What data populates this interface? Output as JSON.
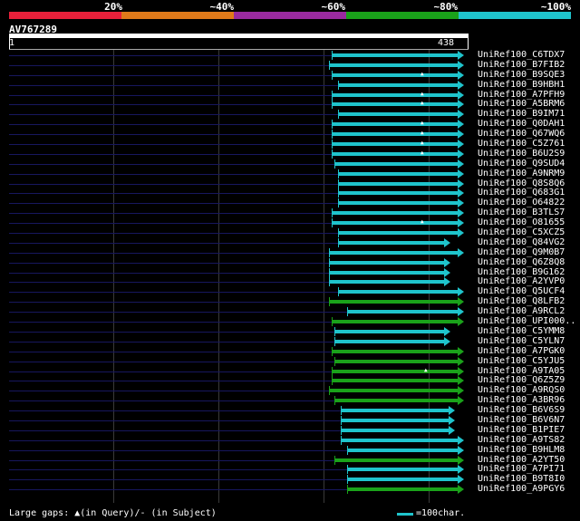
{
  "identity_scale": {
    "labels": [
      "20%",
      "~40%",
      "~60%",
      "~80%",
      "~100%"
    ],
    "colors": [
      "#e8203a",
      "#e07a1a",
      "#9a2aa0",
      "#1aa21a",
      "#1fc4cc"
    ]
  },
  "query": {
    "name": "AV767289",
    "start": "1",
    "end": "438"
  },
  "hits": [
    {
      "label": "UniRef100_C6TDX7",
      "color": "#1fc4cc",
      "start": 366,
      "end": 512,
      "gap": null
    },
    {
      "label": "UniRef100_B7FIB2",
      "color": "#1fc4cc",
      "start": 363,
      "end": 512,
      "gap": null
    },
    {
      "label": "UniRef100_B9SQE3",
      "color": "#1fc4cc",
      "start": 366,
      "end": 512,
      "gap": 466
    },
    {
      "label": "UniRef100_B9HBH1",
      "color": "#1fc4cc",
      "start": 373,
      "end": 512,
      "gap": null
    },
    {
      "label": "UniRef100_A7PFH9",
      "color": "#1fc4cc",
      "start": 366,
      "end": 512,
      "gap": 466
    },
    {
      "label": "UniRef100_A5BRM6",
      "color": "#1fc4cc",
      "start": 366,
      "end": 512,
      "gap": 466
    },
    {
      "label": "UniRef100_B9IM71",
      "color": "#1fc4cc",
      "start": 373,
      "end": 512,
      "gap": null
    },
    {
      "label": "UniRef100_Q0DAH1",
      "color": "#1fc4cc",
      "start": 366,
      "end": 512,
      "gap": 466
    },
    {
      "label": "UniRef100_Q67WQ6",
      "color": "#1fc4cc",
      "start": 366,
      "end": 512,
      "gap": 466
    },
    {
      "label": "UniRef100_C5Z761",
      "color": "#1fc4cc",
      "start": 366,
      "end": 512,
      "gap": 466
    },
    {
      "label": "UniRef100_B6U2S9",
      "color": "#1fc4cc",
      "start": 366,
      "end": 512,
      "gap": 466
    },
    {
      "label": "UniRef100_Q9SUD4",
      "color": "#1fc4cc",
      "start": 369,
      "end": 512,
      "gap": null
    },
    {
      "label": "UniRef100_A9NRM9",
      "color": "#1fc4cc",
      "start": 373,
      "end": 512,
      "gap": null
    },
    {
      "label": "UniRef100_Q8S8Q6",
      "color": "#1fc4cc",
      "start": 373,
      "end": 512,
      "gap": null
    },
    {
      "label": "UniRef100_Q683G1",
      "color": "#1fc4cc",
      "start": 373,
      "end": 512,
      "gap": null
    },
    {
      "label": "UniRef100_O64822",
      "color": "#1fc4cc",
      "start": 373,
      "end": 512,
      "gap": null
    },
    {
      "label": "UniRef100_B3TLS7",
      "color": "#1fc4cc",
      "start": 366,
      "end": 512,
      "gap": null
    },
    {
      "label": "UniRef100_O81655",
      "color": "#1fc4cc",
      "start": 366,
      "end": 512,
      "gap": 466
    },
    {
      "label": "UniRef100_C5XCZ5",
      "color": "#1fc4cc",
      "start": 373,
      "end": 512,
      "gap": null
    },
    {
      "label": "UniRef100_Q84VG2",
      "color": "#1fc4cc",
      "start": 373,
      "end": 497,
      "gap": null
    },
    {
      "label": "UniRef100_Q9M0B7",
      "color": "#1fc4cc",
      "start": 363,
      "end": 512,
      "gap": null
    },
    {
      "label": "UniRef100_Q6Z8Q8",
      "color": "#1fc4cc",
      "start": 363,
      "end": 497,
      "gap": null
    },
    {
      "label": "UniRef100_B9G162",
      "color": "#1fc4cc",
      "start": 363,
      "end": 497,
      "gap": null
    },
    {
      "label": "UniRef100_A2YVP0",
      "color": "#1fc4cc",
      "start": 363,
      "end": 497,
      "gap": null
    },
    {
      "label": "UniRef100_Q5UCF4",
      "color": "#1fc4cc",
      "start": 373,
      "end": 512,
      "gap": null
    },
    {
      "label": "UniRef100_Q8LFB2",
      "color": "#1aa21a",
      "start": 363,
      "end": 512,
      "gap": null
    },
    {
      "label": "UniRef100_A9RCL2",
      "color": "#1fc4cc",
      "start": 383,
      "end": 512,
      "gap": null
    },
    {
      "label": "UniRef100_UPI000..",
      "color": "#1aa21a",
      "start": 366,
      "end": 512,
      "gap": null
    },
    {
      "label": "UniRef100_C5YMM8",
      "color": "#1fc4cc",
      "start": 369,
      "end": 497,
      "gap": null
    },
    {
      "label": "UniRef100_C5YLN7",
      "color": "#1fc4cc",
      "start": 369,
      "end": 497,
      "gap": null
    },
    {
      "label": "UniRef100_A7PGK0",
      "color": "#1aa21a",
      "start": 366,
      "end": 512,
      "gap": null
    },
    {
      "label": "UniRef100_C5YJU5",
      "color": "#1aa21a",
      "start": 369,
      "end": 512,
      "gap": null
    },
    {
      "label": "UniRef100_A9TA05",
      "color": "#1aa21a",
      "start": 366,
      "end": 512,
      "gap": 470
    },
    {
      "label": "UniRef100_Q6Z5Z9",
      "color": "#1aa21a",
      "start": 366,
      "end": 512,
      "gap": null
    },
    {
      "label": "UniRef100_A9RQS0",
      "color": "#1aa21a",
      "start": 363,
      "end": 512,
      "gap": null
    },
    {
      "label": "UniRef100_A3BR96",
      "color": "#1aa21a",
      "start": 369,
      "end": 512,
      "gap": null
    },
    {
      "label": "UniRef100_B6V6S9",
      "color": "#1fc4cc",
      "start": 376,
      "end": 502,
      "gap": null
    },
    {
      "label": "UniRef100_B6V6N7",
      "color": "#1fc4cc",
      "start": 376,
      "end": 502,
      "gap": null
    },
    {
      "label": "UniRef100_B1PIE7",
      "color": "#1fc4cc",
      "start": 376,
      "end": 502,
      "gap": null
    },
    {
      "label": "UniRef100_A9TS82",
      "color": "#1fc4cc",
      "start": 376,
      "end": 512,
      "gap": null
    },
    {
      "label": "UniRef100_B9HLM8",
      "color": "#1fc4cc",
      "start": 383,
      "end": 512,
      "gap": null
    },
    {
      "label": "UniRef100_A2YT50",
      "color": "#1aa21a",
      "start": 369,
      "end": 512,
      "gap": null
    },
    {
      "label": "UniRef100_A7PI71",
      "color": "#1fc4cc",
      "start": 383,
      "end": 512,
      "gap": null
    },
    {
      "label": "UniRef100_B9T8I0",
      "color": "#1fc4cc",
      "start": 383,
      "end": 512,
      "gap": null
    },
    {
      "label": "UniRef100_A9PGY6",
      "color": "#1aa21a",
      "start": 383,
      "end": 512,
      "gap": null
    }
  ],
  "footer": {
    "gaps_label": "Large gaps: ▲(in Query)/- (in Subject)",
    "scale_label": "=100char."
  }
}
